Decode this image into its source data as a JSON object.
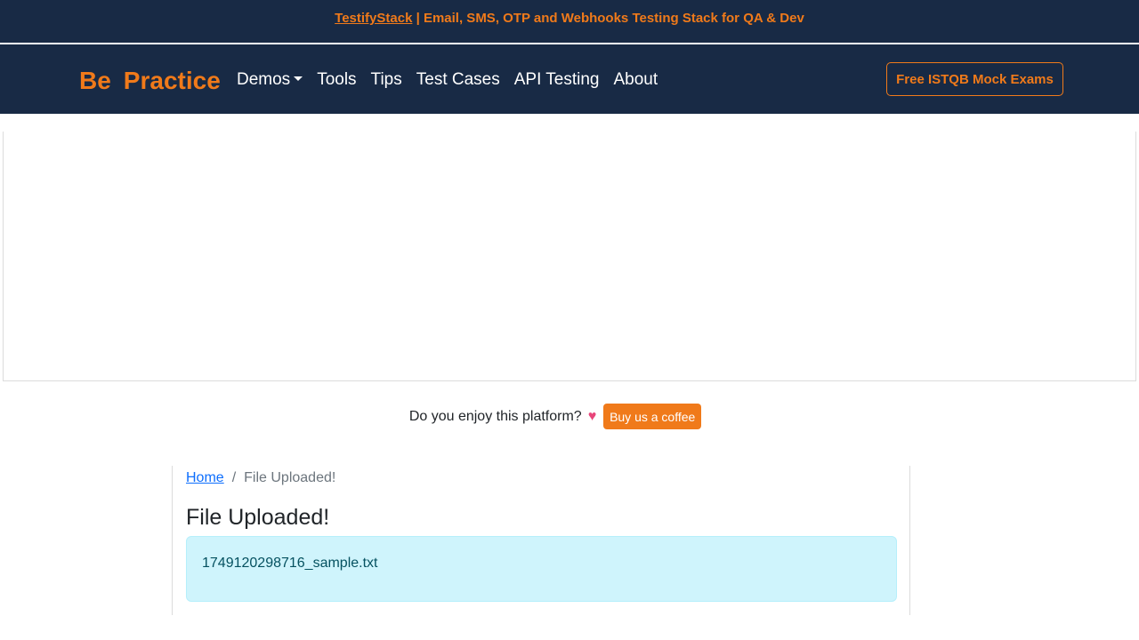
{
  "top_banner": {
    "link_text": "TestifyStack",
    "rest_text": " | Email, SMS, OTP and Webhooks Testing Stack for QA & Dev"
  },
  "navbar": {
    "brand_part1": "Be",
    "brand_part2": "Practice",
    "items": [
      {
        "label": "Demos",
        "has_dropdown": true
      },
      {
        "label": "Tools"
      },
      {
        "label": "Tips"
      },
      {
        "label": "Test Cases"
      },
      {
        "label": "API Testing"
      },
      {
        "label": "About"
      }
    ],
    "cta_label": "Free ISTQB Mock Exams"
  },
  "coffee": {
    "text": "Do you enjoy this platform?",
    "icon": "heart-icon",
    "button_label": "Buy us a coffee"
  },
  "breadcrumb": {
    "home": "Home",
    "separator": "/",
    "current": "File Uploaded!"
  },
  "main": {
    "title": "File Uploaded!",
    "uploaded_file": "1749120298716_sample.txt"
  },
  "colors": {
    "navbar_bg": "#182a45",
    "accent": "#f07a1a",
    "alert_bg": "#cff4fc",
    "alert_text": "#055160",
    "link": "#0d6efd"
  }
}
